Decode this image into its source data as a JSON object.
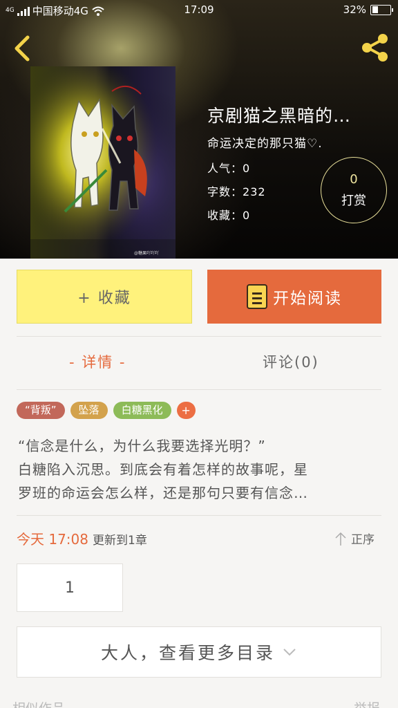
{
  "status_bar": {
    "network_small": "4G",
    "carrier": "中国移动4G",
    "time": "17:09",
    "battery": "32%",
    "battery_level": 0.32
  },
  "header": {
    "back_icon": "chevron-left-icon",
    "share_icon": "share-icon",
    "cover_watermark": "@糖果吖吖吖",
    "title": "京剧猫之黑暗的…",
    "author": "命运决定的那只猫♡.",
    "stats": {
      "popularity_label": "人气：",
      "popularity_value": "0",
      "words_label": "字数：",
      "words_value": "232",
      "favorites_label": "收藏：",
      "favorites_value": "0"
    },
    "reward": {
      "count": "0",
      "label": "打赏"
    }
  },
  "actions": {
    "collect_label": "+ 收藏",
    "read_label": "开始阅读"
  },
  "tabs": {
    "detail": "- 详情 -",
    "comments": "评论(0)"
  },
  "tags": [
    {
      "label": "“背叛”",
      "color": "#c2685a"
    },
    {
      "label": "坠落",
      "color": "#d3a24c"
    },
    {
      "label": "白糖黑化",
      "color": "#8dbb58"
    }
  ],
  "tag_add_label": "+",
  "synopsis": {
    "line1": "“信念是什么，为什么我要选择光明？”",
    "line2": "白糖陷入沉思。到底会有着怎样的故事呢，星",
    "line3": "罗班的命运会怎么样，还是那句只要有信念…"
  },
  "update": {
    "time": "今天 17:08",
    "text": "更新到1章"
  },
  "sort": {
    "icon": "arrow-up-icon",
    "label": "正序"
  },
  "chapters": [
    "1"
  ],
  "more_catalog": {
    "label": "大人，查看更多目录",
    "icon": "chevron-down-icon"
  },
  "footer": {
    "left": "相似作品",
    "right": "举报"
  },
  "colors": {
    "accent": "#e56a3d",
    "collect_bg": "#fff27c"
  }
}
